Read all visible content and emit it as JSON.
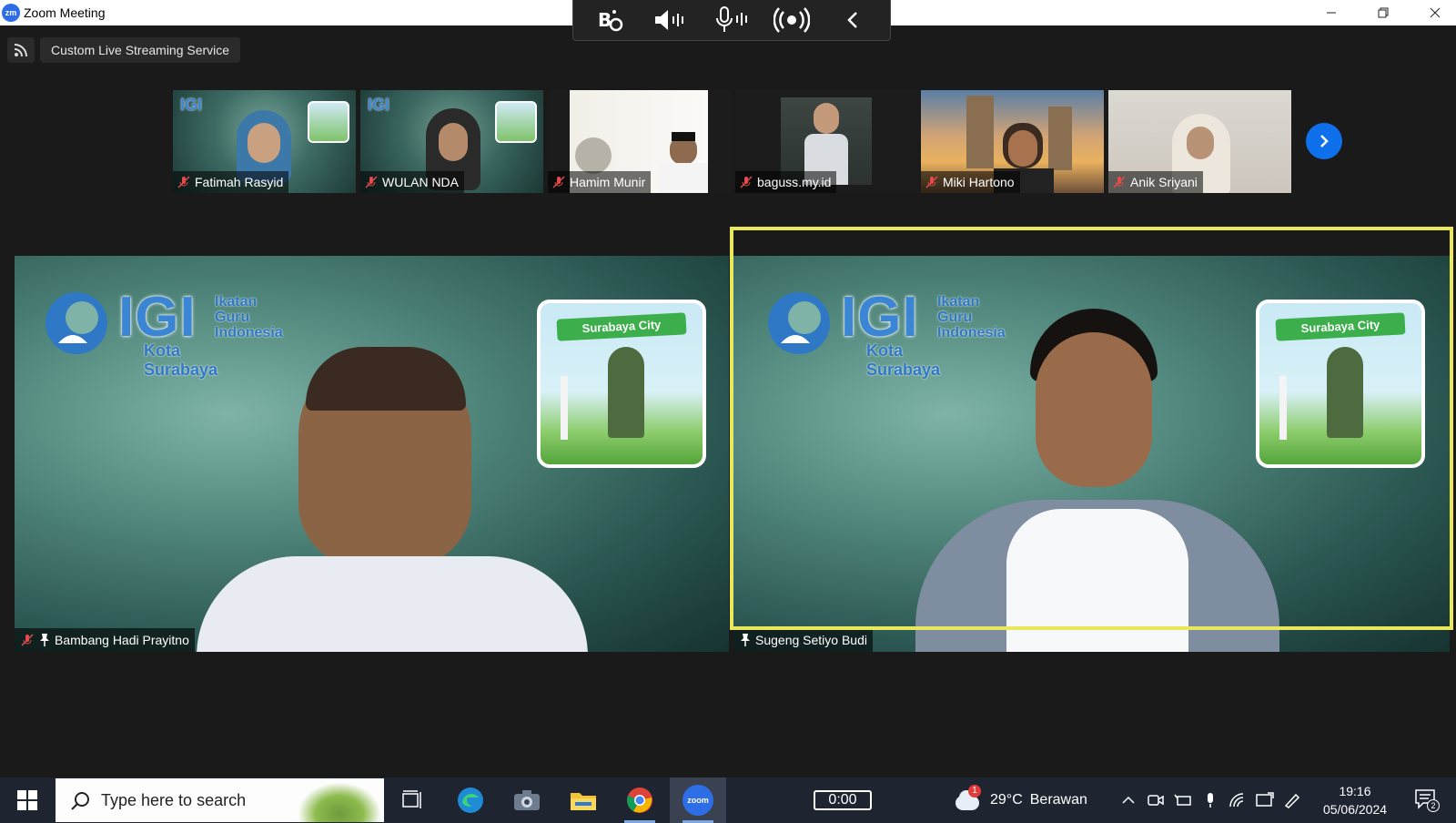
{
  "window": {
    "logo_text": "zm",
    "title": "Zoom Meeting",
    "controls": [
      "minimize",
      "restore",
      "close"
    ]
  },
  "a11y_toolbar": {
    "icons": [
      "accessibility-icon",
      "volume-icon",
      "microphone-icon",
      "broadcast-icon",
      "collapse-chevron-icon"
    ]
  },
  "streaming": {
    "label": "Custom Live Streaming Service"
  },
  "thumbnails": [
    {
      "name": "Fatimah Rasyid",
      "muted": true
    },
    {
      "name": "WULAN NDA",
      "muted": true
    },
    {
      "name": "Hamim Munir",
      "muted": true
    },
    {
      "name": "baguss.my.id",
      "muted": true
    },
    {
      "name": "Miki Hartono",
      "muted": true
    },
    {
      "name": "Anik Sriyani",
      "muted": true
    }
  ],
  "tiles": [
    {
      "name": "Bambang Hadi Prayitno",
      "muted": true,
      "pinned": true,
      "active_speaker": false,
      "logo": {
        "main": "IGI",
        "line1": "Ikatan",
        "line2": "Guru",
        "line3": "Indonesia",
        "city": "Kota Surabaya"
      },
      "badge": "Surabaya City"
    },
    {
      "name": "Sugeng Setiyo Budi",
      "muted": false,
      "pinned": true,
      "active_speaker": true,
      "logo": {
        "main": "IGI",
        "line1": "Ikatan",
        "line2": "Guru",
        "line3": "Indonesia",
        "city": "Kota Surabaya"
      },
      "badge": "Surabaya City"
    }
  ],
  "taskbar": {
    "search_placeholder": "Type here to search",
    "apps": [
      "task-view-icon",
      "edge-icon",
      "camera-icon",
      "file-explorer-icon",
      "chrome-icon",
      "zoom-icon"
    ],
    "active_app": "zoom-icon",
    "zoom_label": "zoom",
    "timer": "0:00",
    "weather": {
      "temp": "29°C",
      "condition": "Berawan",
      "alert_count": "1"
    },
    "clock": {
      "time": "19:16",
      "date": "05/06/2024"
    },
    "notification_count": "2"
  },
  "colors": {
    "active_speaker_border": "#e8e85a",
    "zoom_blue": "#0e71eb",
    "taskbar": "#1f2530",
    "stage": "#1a1a1a"
  }
}
